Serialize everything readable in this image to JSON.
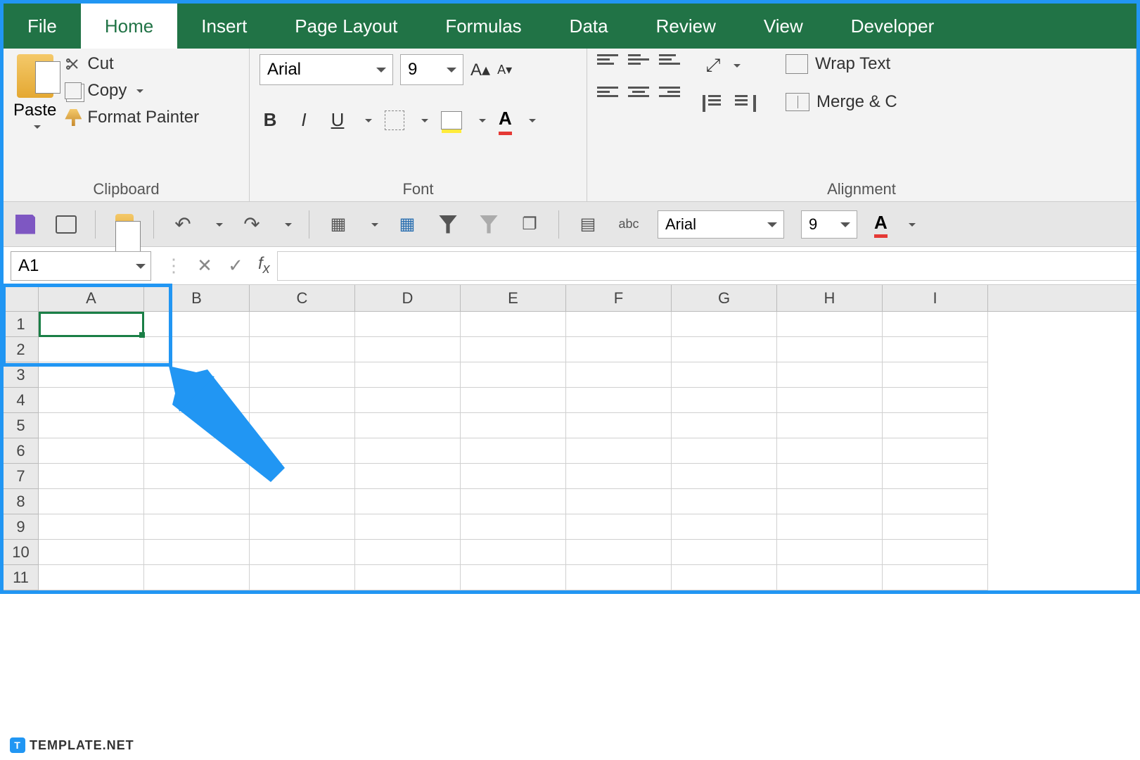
{
  "tabs": [
    "File",
    "Home",
    "Insert",
    "Page Layout",
    "Formulas",
    "Data",
    "Review",
    "View",
    "Developer"
  ],
  "active_tab_index": 1,
  "clipboard": {
    "paste": "Paste",
    "cut": "Cut",
    "copy": "Copy",
    "format_painter": "Format Painter",
    "group_label": "Clipboard"
  },
  "font": {
    "name": "Arial",
    "size": "9",
    "group_label": "Font"
  },
  "alignment": {
    "wrap": "Wrap Text",
    "merge": "Merge & C",
    "group_label": "Alignment"
  },
  "qat": {
    "font_name": "Arial",
    "font_size": "9"
  },
  "namebox": "A1",
  "columns": [
    "A",
    "B",
    "C",
    "D",
    "E",
    "F",
    "G",
    "H",
    "I"
  ],
  "rows": [
    "1",
    "2",
    "3",
    "4",
    "5",
    "6",
    "7",
    "8",
    "9",
    "10",
    "11"
  ],
  "selected_cell": "A1",
  "watermark": "TEMPLATE.NET"
}
